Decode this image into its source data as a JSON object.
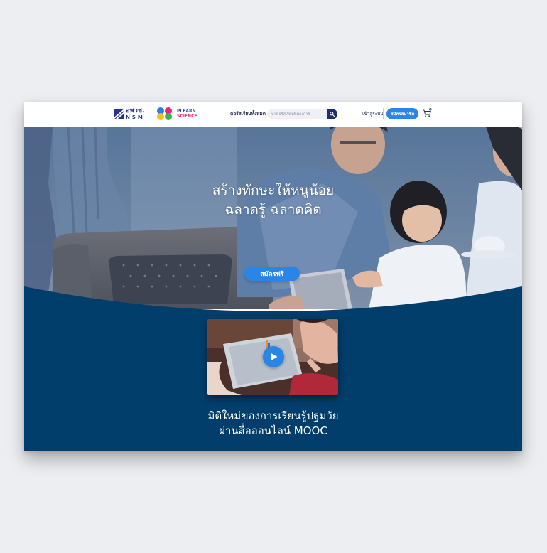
{
  "nav": {
    "logo_nsm_th": "อพวช.",
    "logo_nsm_en": "NSM",
    "logo_plearn_1": "PLEARN",
    "logo_plearn_2": "SCIENCE",
    "all_courses": "คอร์สเรียนทั้งหมด",
    "search_placeholder": "หาคอร์สเรียนที่ต้องการ",
    "login": "เข้าสู่ระบบ",
    "signup": "สมัครสมาชิก"
  },
  "hero": {
    "title_line1": "สร้างทักษะให้หนูน้อย",
    "title_line2": "ฉลาดรู้ ฉลาดคิด",
    "cta": "สมัครฟรี"
  },
  "section": {
    "title_line1": "มิติใหม่ของการเรียนรู้ปฐมวัย",
    "title_line2": "ผ่านสื่อออนไลน์ MOOC"
  },
  "colors": {
    "page_bg": "#eceef2",
    "brand_navy": "#1f2d6e",
    "accent_blue": "#2a86e6",
    "section_bg": "#023e6b"
  },
  "icons": {
    "search": "search-icon",
    "cart": "cart-icon",
    "play": "play-icon"
  }
}
